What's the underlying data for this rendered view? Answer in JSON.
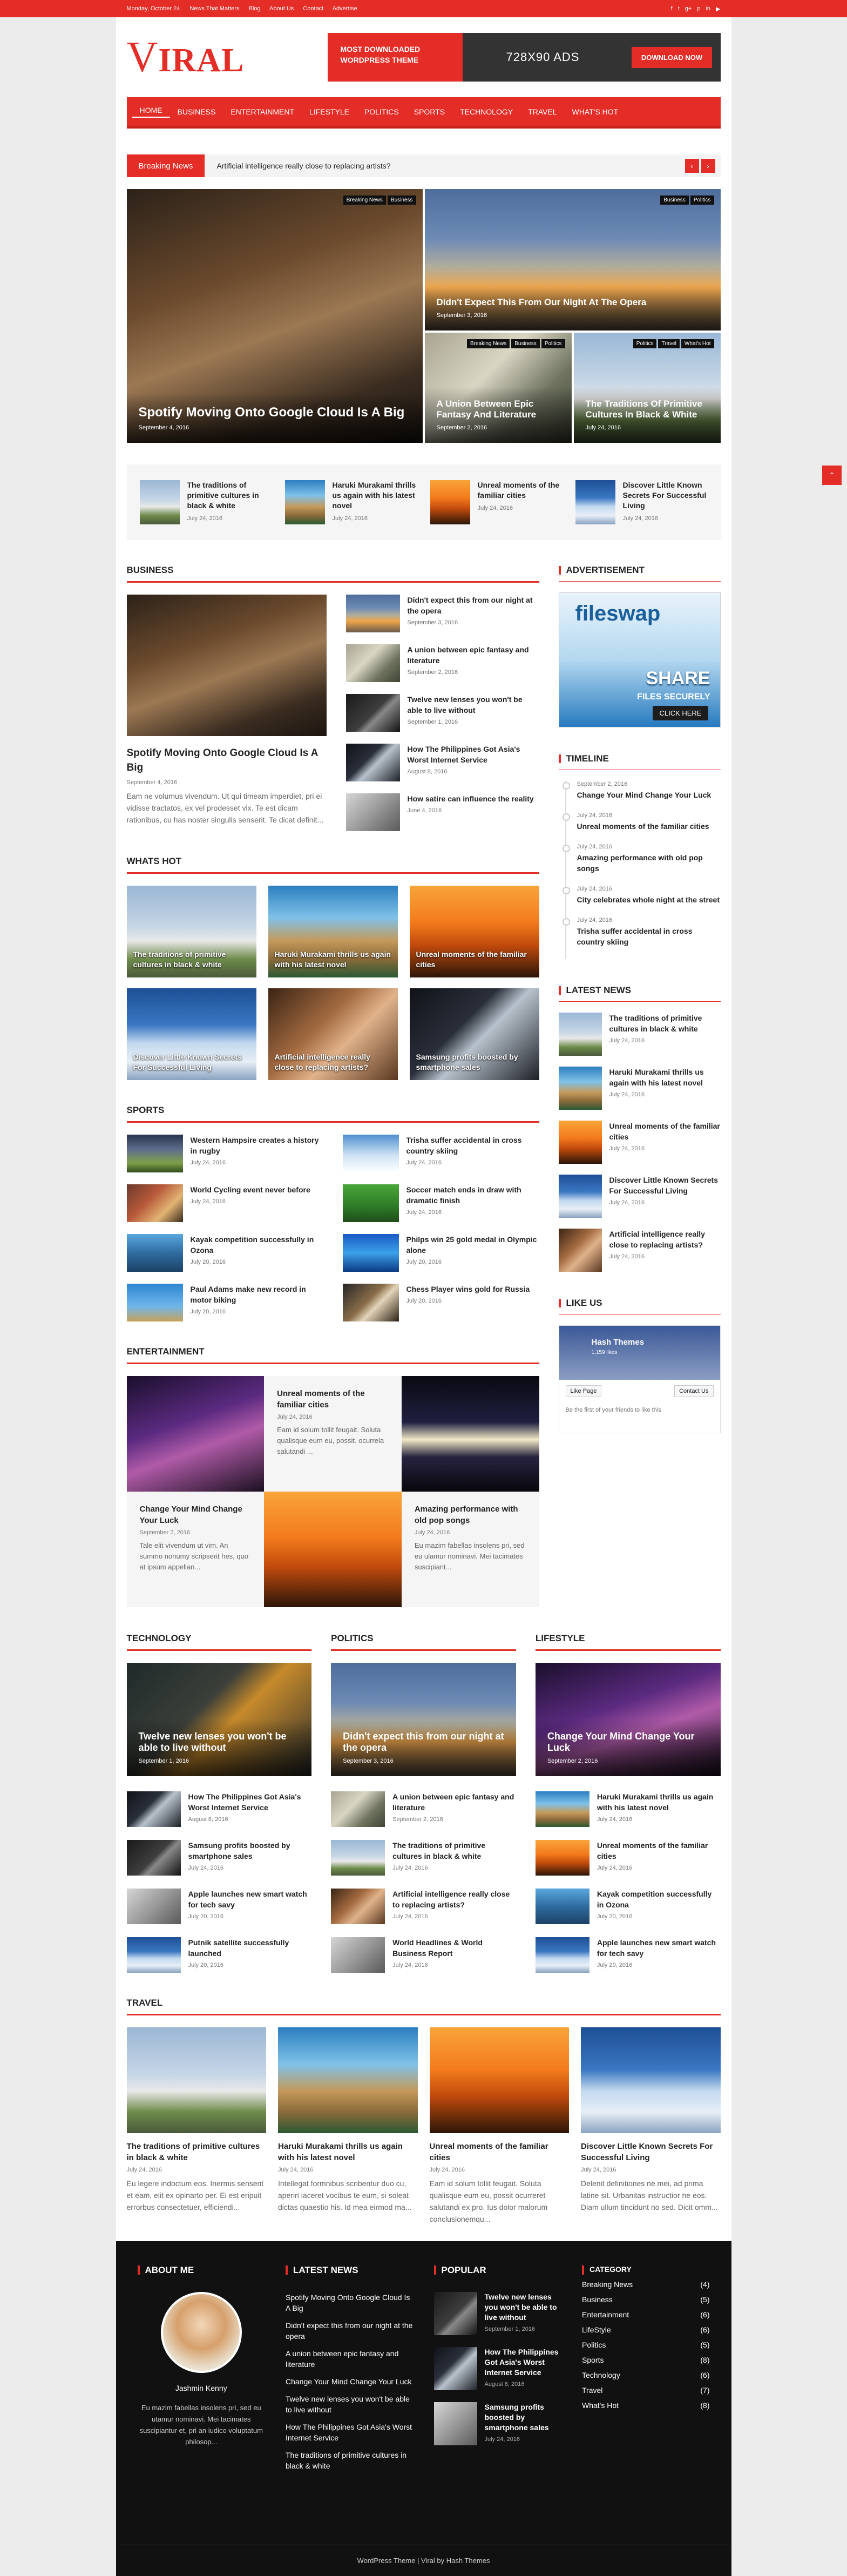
{
  "topbar": {
    "date": "Monday, October 24",
    "links": [
      "News That Matters",
      "Blog",
      "About Us",
      "Contact",
      "Advertise"
    ],
    "social": [
      "f",
      "t",
      "g+",
      "p",
      "in",
      "▶"
    ]
  },
  "logo": "IRAL",
  "logo_first": "V",
  "ad": {
    "left": "MOST DOWNLOADED WORDPRESS THEME",
    "middle": "728X90 ADS",
    "button": "DOWNLOAD NOW"
  },
  "nav": [
    "Home",
    "Business",
    "Entertainment",
    "Lifestyle",
    "Politics",
    "Sports",
    "Technology",
    "Travel",
    "What's Hot"
  ],
  "ticker": {
    "label": "Breaking News",
    "text": "Artificial intelligence really close to replacing artists?"
  },
  "hero": {
    "big": {
      "title": "Spotify Moving Onto Google Cloud Is A Big",
      "date": "September 4, 2016",
      "tags": [
        "Breaking News",
        "Business"
      ]
    },
    "top": {
      "title": "Didn't Expect This From Our Night At The Opera",
      "date": "September 3, 2016",
      "tags": [
        "Business",
        "Politics"
      ]
    },
    "b1": {
      "title": "A Union Between Epic Fantasy And Literature",
      "date": "September 2, 2016",
      "tags": [
        "Breaking News",
        "Business",
        "Politics"
      ]
    },
    "b2": {
      "title": "The Traditions Of Primitive Cultures In Black & White",
      "date": "July 24, 2016",
      "tags": [
        "Politics",
        "Travel",
        "What's Hot"
      ]
    }
  },
  "strip": [
    {
      "title": "The traditions of primitive cultures in black & white",
      "date": "July 24, 2016"
    },
    {
      "title": "Haruki Murakami thrills us again with his latest novel",
      "date": "July 24, 2016"
    },
    {
      "title": "Unreal moments of the familiar cities",
      "date": "July 24, 2016"
    },
    {
      "title": "Discover Little Known Secrets For Successful Living",
      "date": "July 24, 2016"
    }
  ],
  "business": {
    "heading": "Business",
    "feat": {
      "title": "Spotify Moving Onto Google Cloud Is A Big",
      "date": "September 4, 2016",
      "excerpt": "Eam ne volumus vivendum. Ut qui timeam imperdiet, pri ei vidisse tractatos, ex vel prodesset vix. Te est dicam rationibus, cu has noster singulis senserit. Te dicat definit..."
    },
    "list": [
      {
        "title": "Didn't expect this from our night at the opera",
        "date": "September 3, 2016"
      },
      {
        "title": "A union between epic fantasy and literature",
        "date": "September 2, 2016"
      },
      {
        "title": "Twelve new lenses you won't be able to live without",
        "date": "September 1, 2016"
      },
      {
        "title": "How The Philippines Got Asia's Worst Internet Service",
        "date": "August 8, 2016"
      },
      {
        "title": "How satire can influence the reality",
        "date": "June 4, 2016"
      }
    ]
  },
  "hot": {
    "heading": "Whats Hot",
    "items": [
      "The traditions of primitive cultures in black & white",
      "Haruki Murakami thrills us again with his latest novel",
      "Unreal moments of the familiar cities",
      "Discover Little Known Secrets For Successful Living",
      "Artificial intelligence really close to replacing artists?",
      "Samsung profits boosted by smartphone sales"
    ]
  },
  "sports": {
    "heading": "Sports",
    "items": [
      {
        "title": "Western Hampsire creates a history in rugby",
        "date": "July 24, 2016"
      },
      {
        "title": "Trisha suffer accidental in cross country skiing",
        "date": "July 24, 2016"
      },
      {
        "title": "World Cycling event never before",
        "date": "July 24, 2016"
      },
      {
        "title": "Soccer match ends in draw with dramatic finish",
        "date": "July 24, 2016"
      },
      {
        "title": "Kayak competition successfully in Ozona",
        "date": "July 20, 2016"
      },
      {
        "title": "Philps win 25 gold medal in Olympic alone",
        "date": "July 20, 2016"
      },
      {
        "title": "Paul Adams make new record in motor biking",
        "date": "July 20, 2016"
      },
      {
        "title": "Chess Player wins gold for Russia",
        "date": "July 20, 2016"
      }
    ]
  },
  "entertainment": {
    "heading": "Entertainment",
    "items": [
      {
        "title": "Unreal moments of the familiar cities",
        "date": "July 24, 2016",
        "excerpt": "Eam id solum tollit feugait. Soluta qualisque eum eu, possit. ocurrela salutandi ..."
      },
      {
        "title": "Change Your Mind Change Your Luck",
        "date": "September 2, 2016",
        "excerpt": "Tale elit vivendum ut vim. An summo nonumy scripserit hes, quo at ipsum appellan..."
      },
      {
        "title": "Amazing performance with old pop songs",
        "date": "July 24, 2016",
        "excerpt": "Eu mazim fabellas insolens pri, sed eu ulamur nominavi. Mei tacimates suscipiant..."
      }
    ]
  },
  "sidebar": {
    "ad_heading": "Advertisement",
    "ad": {
      "brand": "fileswap",
      "share": "SHARE",
      "files": "FILES SECURELY",
      "click": "CLICK HERE"
    },
    "timeline_heading": "Timeline",
    "timeline": [
      {
        "date": "September 2, 2016",
        "title": "Change Your Mind Change Your Luck"
      },
      {
        "date": "July 24, 2016",
        "title": "Unreal moments of the familiar cities"
      },
      {
        "date": "July 24, 2016",
        "title": "Amazing performance with old pop songs"
      },
      {
        "date": "July 24, 2016",
        "title": "City celebrates whole night at the street"
      },
      {
        "date": "July 24, 2016",
        "title": "Trisha suffer accidental in cross country skiing"
      }
    ],
    "latest_heading": "Latest News",
    "latest": [
      {
        "title": "The traditions of primitive cultures in black & white",
        "date": "July 24, 2016"
      },
      {
        "title": "Haruki Murakami thrills us again with his latest novel",
        "date": "July 24, 2016"
      },
      {
        "title": "Unreal moments of the familiar cities",
        "date": "July 24, 2016"
      },
      {
        "title": "Discover Little Known Secrets For Successful Living",
        "date": "July 24, 2016"
      },
      {
        "title": "Artificial intelligence really close to replacing artists?",
        "date": "July 24, 2016"
      }
    ],
    "like_heading": "Like Us",
    "fb": {
      "name": "Hash Themes",
      "likes": "1,159 likes",
      "like": "Like Page",
      "contact": "Contact Us",
      "friends": "Be the first of your friends to like this"
    }
  },
  "technology": {
    "heading": "Technology",
    "feat": {
      "title": "Twelve new lenses you won't be able to live without",
      "date": "September 1, 2016"
    },
    "list": [
      {
        "title": "How The Philippines Got Asia's Worst Internet Service",
        "date": "August 8, 2016"
      },
      {
        "title": "Samsung profits boosted by smartphone sales",
        "date": "July 24, 2016"
      },
      {
        "title": "Apple launches new smart watch for tech savy",
        "date": "July 20, 2016"
      },
      {
        "title": "Putnik satellite successfully launched",
        "date": "July 20, 2016"
      }
    ]
  },
  "politics": {
    "heading": "Politics",
    "feat": {
      "title": "Didn't expect this from our night at the opera",
      "date": "September 3, 2016"
    },
    "list": [
      {
        "title": "A union between epic fantasy and literature",
        "date": "September 2, 2016"
      },
      {
        "title": "The traditions of primitive cultures in black & white",
        "date": "July 24, 2016"
      },
      {
        "title": "Artificial intelligence really close to replacing artists?",
        "date": "July 24, 2016"
      },
      {
        "title": "World Headlines & World Business Report",
        "date": "July 24, 2016"
      }
    ]
  },
  "lifestyle": {
    "heading": "Lifestyle",
    "feat": {
      "title": "Change Your Mind Change Your Luck",
      "date": "September 2, 2016"
    },
    "list": [
      {
        "title": "Haruki Murakami thrills us again with his latest novel",
        "date": "July 24, 2016"
      },
      {
        "title": "Unreal moments of the familiar cities",
        "date": "July 24, 2016"
      },
      {
        "title": "Kayak competition successfully in Ozona",
        "date": "July 20, 2016"
      },
      {
        "title": "Apple launches new smart watch for tech savy",
        "date": "July 20, 2016"
      }
    ]
  },
  "travel": {
    "heading": "Travel",
    "items": [
      {
        "title": "The traditions of primitive cultures in black & white",
        "date": "July 24, 2016",
        "excerpt": "Eu legere indoctum eos. Inermis senserit et eam, elit ex opinarto per. Ei est eripuit errorbus consectetuer, efficiendi..."
      },
      {
        "title": "Haruki Murakami thrills us again with his latest novel",
        "date": "July 24, 2016",
        "excerpt": "Intellegat formnibus scribentur duo cu, aperiri iaceret vocibus te eum, si soleat dictas quaestio his. Id mea eirmod ma..."
      },
      {
        "title": "Unreal moments of the familiar cities",
        "date": "July 24, 2016",
        "excerpt": "Eam id solum tollit feugait. Soluta qualisque eum eu, possit ocurreret salutandi ex pro. Ius dolor malorum conclusionemqu..."
      },
      {
        "title": "Discover Little Known Secrets For Successful Living",
        "date": "July 24, 2016",
        "excerpt": "Delenit definitiones ne mei, ad prima latine sit. Urbanitas instructior ne eos. Diam ullum tincidunt no sed. Dicit omm..."
      }
    ]
  },
  "footer": {
    "about_heading": "About Me",
    "name": "Jashmin Kenny",
    "about": "Eu mazim fabellas insolens pri, sed eu utamur nominavi. Mei tacimates suscipiantur et, pri an iudico voluptatum philosop...",
    "latest_heading": "Latest News",
    "latest": [
      "Spotify Moving Onto Google Cloud Is A Big",
      "Didn't expect this from our night at the opera",
      "A union between epic fantasy and literature",
      "Change Your Mind Change Your Luck",
      "Twelve new lenses you won't be able to live without",
      "How The Philippines Got Asia's Worst Internet Service",
      "The traditions of primitive cultures in black & white"
    ],
    "popular_heading": "Popular",
    "popular": [
      {
        "title": "Twelve new lenses you won't be able to live without",
        "date": "September 1, 2016"
      },
      {
        "title": "How The Philippines Got Asia's Worst Internet Service",
        "date": "August 8, 2016"
      },
      {
        "title": "Samsung profits boosted by smartphone sales",
        "date": "July 24, 2016"
      }
    ],
    "category_heading": "Category",
    "categories": [
      {
        "name": "Breaking News",
        "count": "(4)"
      },
      {
        "name": "Business",
        "count": "(5)"
      },
      {
        "name": "Entertainment",
        "count": "(6)"
      },
      {
        "name": "LifeStyle",
        "count": "(6)"
      },
      {
        "name": "Politics",
        "count": "(5)"
      },
      {
        "name": "Sports",
        "count": "(8)"
      },
      {
        "name": "Technology",
        "count": "(6)"
      },
      {
        "name": "Travel",
        "count": "(7)"
      },
      {
        "name": "What's Hot",
        "count": "(8)"
      }
    ],
    "copyright": "WordPress Theme | Viral by Hash Themes"
  }
}
